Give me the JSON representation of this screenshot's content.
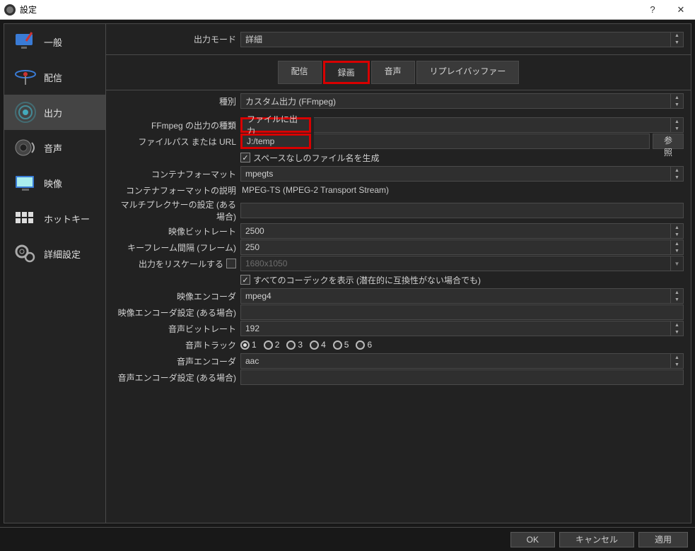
{
  "titlebar": {
    "title": "設定"
  },
  "sidebar": {
    "items": [
      {
        "label": "一般"
      },
      {
        "label": "配信"
      },
      {
        "label": "出力"
      },
      {
        "label": "音声"
      },
      {
        "label": "映像"
      },
      {
        "label": "ホットキー"
      },
      {
        "label": "詳細設定"
      }
    ]
  },
  "topstrip": {
    "mode_label": "出力モード",
    "mode_value": "詳細"
  },
  "tabs": {
    "items": [
      {
        "label": "配信"
      },
      {
        "label": "録画"
      },
      {
        "label": "音声"
      },
      {
        "label": "リプレイバッファー"
      }
    ]
  },
  "form": {
    "type_label": "種別",
    "type_value": "カスタム出力 (FFmpeg)",
    "ffmpeg_out_label": "FFmpeg の出力の種類",
    "ffmpeg_out_value": "ファイルに出力",
    "filepath_label": "ファイルパス または URL",
    "filepath_value": "J:/temp",
    "browse_btn": "参照",
    "nospace_label": "スペースなしのファイル名を生成",
    "container_label": "コンテナフォーマット",
    "container_value": "mpegts",
    "container_desc_label": "コンテナフォーマットの説明",
    "container_desc_value": "MPEG-TS (MPEG-2 Transport Stream)",
    "muxer_label": "マルチプレクサーの設定 (ある場合)",
    "muxer_value": "",
    "vbitrate_label": "映像ビットレート",
    "vbitrate_value": "2500",
    "keyframe_label": "キーフレーム間隔 (フレーム)",
    "keyframe_value": "250",
    "rescale_label": "出力をリスケールする",
    "rescale_value": "1680x1050",
    "allcodecs_label": "すべてのコーデックを表示 (潜在的に互換性がない場合でも)",
    "vencoder_label": "映像エンコーダ",
    "vencoder_value": "mpeg4",
    "vencoder_set_label": "映像エンコーダ設定 (ある場合)",
    "vencoder_set_value": "",
    "abitrate_label": "音声ビットレート",
    "abitrate_value": "192",
    "tracks_label": "音声トラック",
    "tracks": [
      "1",
      "2",
      "3",
      "4",
      "5",
      "6"
    ],
    "aencoder_label": "音声エンコーダ",
    "aencoder_value": "aac",
    "aencoder_set_label": "音声エンコーダ設定 (ある場合)",
    "aencoder_set_value": ""
  },
  "footer": {
    "ok": "OK",
    "cancel": "キャンセル",
    "apply": "適用"
  }
}
